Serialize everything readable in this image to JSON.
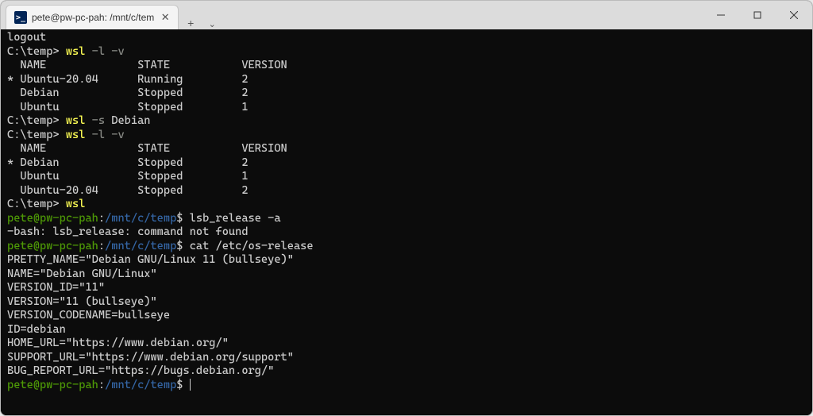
{
  "tab": {
    "icon_glyph": ">_",
    "title": "pete@pw-pc-pah: /mnt/c/tem",
    "close_glyph": "✕"
  },
  "titlebar": {
    "newtab_glyph": "+",
    "dropdown_glyph": "⌄"
  },
  "terminal": {
    "lines": [
      {
        "t": "plain",
        "text": "logout"
      },
      {
        "t": "cmdwin",
        "prompt": "C:\\temp> ",
        "cmd": "wsl",
        "rest": " -l -v",
        "rest_flag": true
      },
      {
        "t": "plain",
        "text": "  NAME              STATE           VERSION"
      },
      {
        "t": "plain",
        "text": "* Ubuntu-20.04      Running         2"
      },
      {
        "t": "plain",
        "text": "  Debian            Stopped         2"
      },
      {
        "t": "plain",
        "text": "  Ubuntu            Stopped         1"
      },
      {
        "t": "cmdwin",
        "prompt": "C:\\temp> ",
        "cmd": "wsl",
        "rest": " -s Debian"
      },
      {
        "t": "cmdwin",
        "prompt": "C:\\temp> ",
        "cmd": "wsl",
        "rest": " -l -v",
        "rest_flag": true
      },
      {
        "t": "plain",
        "text": "  NAME              STATE           VERSION"
      },
      {
        "t": "plain",
        "text": "* Debian            Stopped         2"
      },
      {
        "t": "plain",
        "text": "  Ubuntu            Stopped         1"
      },
      {
        "t": "plain",
        "text": "  Ubuntu-20.04      Stopped         2"
      },
      {
        "t": "cmdwin",
        "prompt": "C:\\temp> ",
        "cmd": "wsl",
        "rest": ""
      },
      {
        "t": "bash",
        "user": "pete@pw-pc-pah",
        "path": "/mnt/c/temp",
        "cmd": "lsb_release -a"
      },
      {
        "t": "plain",
        "text": "-bash: lsb_release: command not found"
      },
      {
        "t": "bash",
        "user": "pete@pw-pc-pah",
        "path": "/mnt/c/temp",
        "cmd": "cat /etc/os-release"
      },
      {
        "t": "plain",
        "text": "PRETTY_NAME=\"Debian GNU/Linux 11 (bullseye)\""
      },
      {
        "t": "plain",
        "text": "NAME=\"Debian GNU/Linux\""
      },
      {
        "t": "plain",
        "text": "VERSION_ID=\"11\""
      },
      {
        "t": "plain",
        "text": "VERSION=\"11 (bullseye)\""
      },
      {
        "t": "plain",
        "text": "VERSION_CODENAME=bullseye"
      },
      {
        "t": "plain",
        "text": "ID=debian"
      },
      {
        "t": "plain",
        "text": "HOME_URL=\"https://www.debian.org/\""
      },
      {
        "t": "plain",
        "text": "SUPPORT_URL=\"https://www.debian.org/support\""
      },
      {
        "t": "plain",
        "text": "BUG_REPORT_URL=\"https://bugs.debian.org/\""
      },
      {
        "t": "bash",
        "user": "pete@pw-pc-pah",
        "path": "/mnt/c/temp",
        "cmd": "",
        "cursor": true
      }
    ]
  }
}
